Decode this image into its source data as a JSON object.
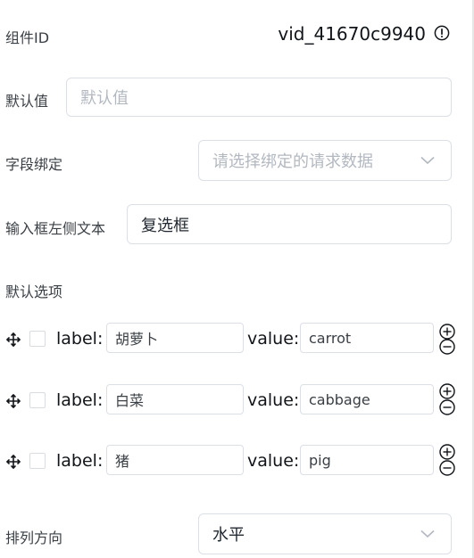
{
  "component_id": {
    "label": "组件ID",
    "value": "vid_41670c9940",
    "icon": "info-circle-icon"
  },
  "default_value": {
    "label": "默认值",
    "placeholder": "默认值",
    "value": ""
  },
  "field_binding": {
    "label": "字段绑定",
    "placeholder": "请选择绑定的请求数据",
    "icon": "chevron-down-icon"
  },
  "input_left_text": {
    "label": "输入框左侧文本",
    "value": "复选框"
  },
  "default_options": {
    "label": "默认选项",
    "label_key": "label:",
    "value_key": "value:",
    "items": [
      {
        "label": "胡萝卜",
        "value": "carrot",
        "checked": false
      },
      {
        "label": "白菜",
        "value": "cabbage",
        "checked": false
      },
      {
        "label": "猪",
        "value": "pig",
        "checked": false
      }
    ]
  },
  "arrangement": {
    "label": "排列方向",
    "value": "水平",
    "icon": "chevron-down-icon"
  },
  "colors": {
    "border": "#dcdfe6",
    "placeholder": "#b3b8c0",
    "label": "#3a3f45",
    "text": "#111418"
  }
}
